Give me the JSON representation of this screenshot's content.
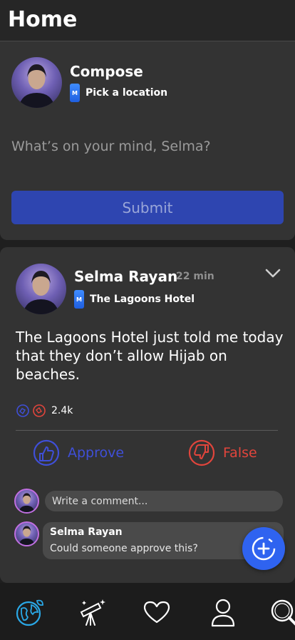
{
  "header": {
    "title": "Home"
  },
  "compose": {
    "title": "Compose",
    "location_label": "Pick a location",
    "placeholder": "What’s on your mind, Selma?",
    "submit_label": "Submit"
  },
  "post": {
    "author": "Selma Rayan",
    "time": "22 min",
    "location": "The Lagoons Hotel",
    "body": "The Lagoons Hotel just told me today that they don’t allow Hijab on beaches.",
    "reaction_count": "2.4k",
    "approve_label": "Approve",
    "false_label": "False",
    "comment_placeholder": "Write a comment...",
    "comments": [
      {
        "author": "Selma Rayan",
        "text": "Could someone approve this?"
      }
    ]
  },
  "icons": {
    "location": "location-pin-icon",
    "chevron": "chevron-down-icon",
    "approve": "thumbs-up-icon",
    "false": "thumbs-down-icon",
    "add": "add-icon",
    "nav": [
      "globe-icon",
      "telescope-icon",
      "heart-icon",
      "profile-icon",
      "search-icon"
    ]
  },
  "colors": {
    "accent": "#2f63f0",
    "submit": "#2e45b0",
    "approve": "#3f4fd8",
    "false": "#e2453c",
    "active_nav": "#2aa8e6"
  }
}
